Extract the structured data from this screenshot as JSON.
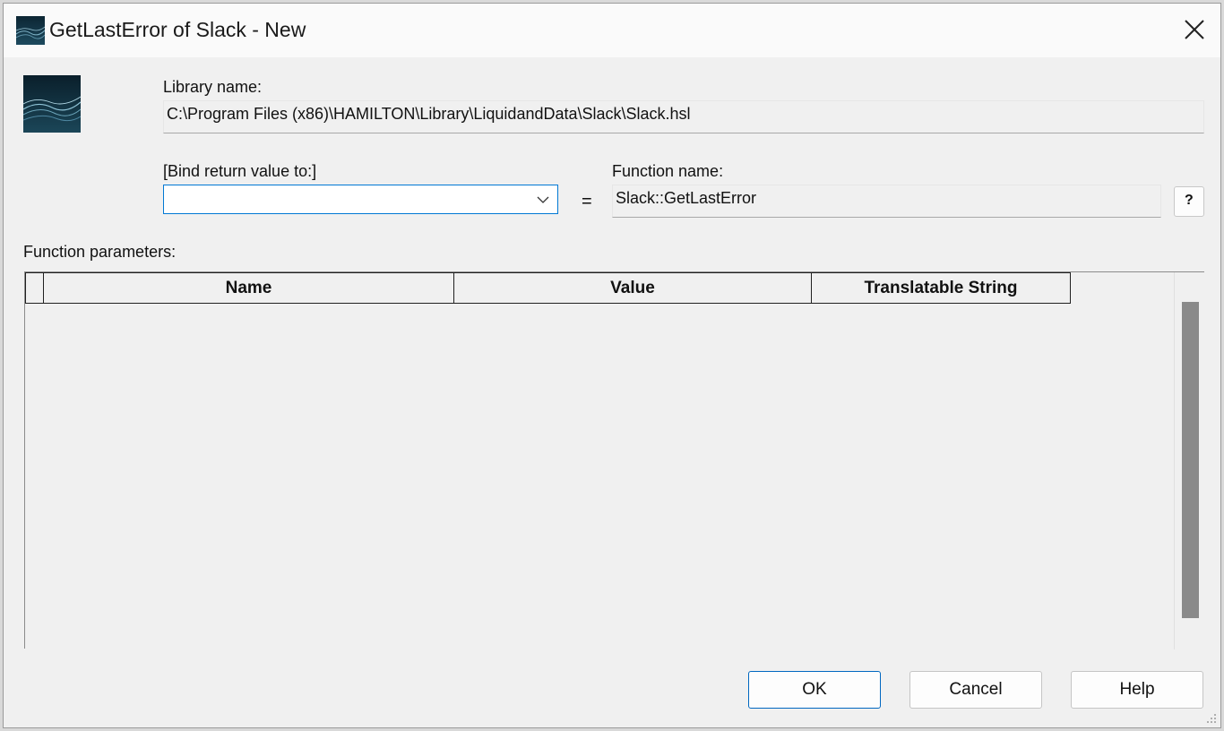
{
  "window": {
    "title": "GetLastError of Slack - New",
    "app_icon": "hamilton-app-icon",
    "close_icon": "close-icon"
  },
  "library": {
    "label": "Library name:",
    "value": "C:\\Program Files (x86)\\HAMILTON\\Library\\LiquidandData\\Slack\\Slack.hsl"
  },
  "bind": {
    "label": "[Bind return value to:]",
    "value": "",
    "dropdown_icon": "chevron-down-icon"
  },
  "equals_sign": "=",
  "function": {
    "label": "Function name:",
    "value": "Slack::GetLastError",
    "help_glyph": "?"
  },
  "parameters": {
    "label": "Function parameters:",
    "columns": [
      "Name",
      "Value",
      "Translatable String"
    ],
    "rows": []
  },
  "buttons": {
    "ok": "OK",
    "cancel": "Cancel",
    "help": "Help"
  },
  "colors": {
    "focus_border": "#0078d4",
    "background": "#f0f0f0",
    "scroll_thumb": "#8a8a8a"
  }
}
